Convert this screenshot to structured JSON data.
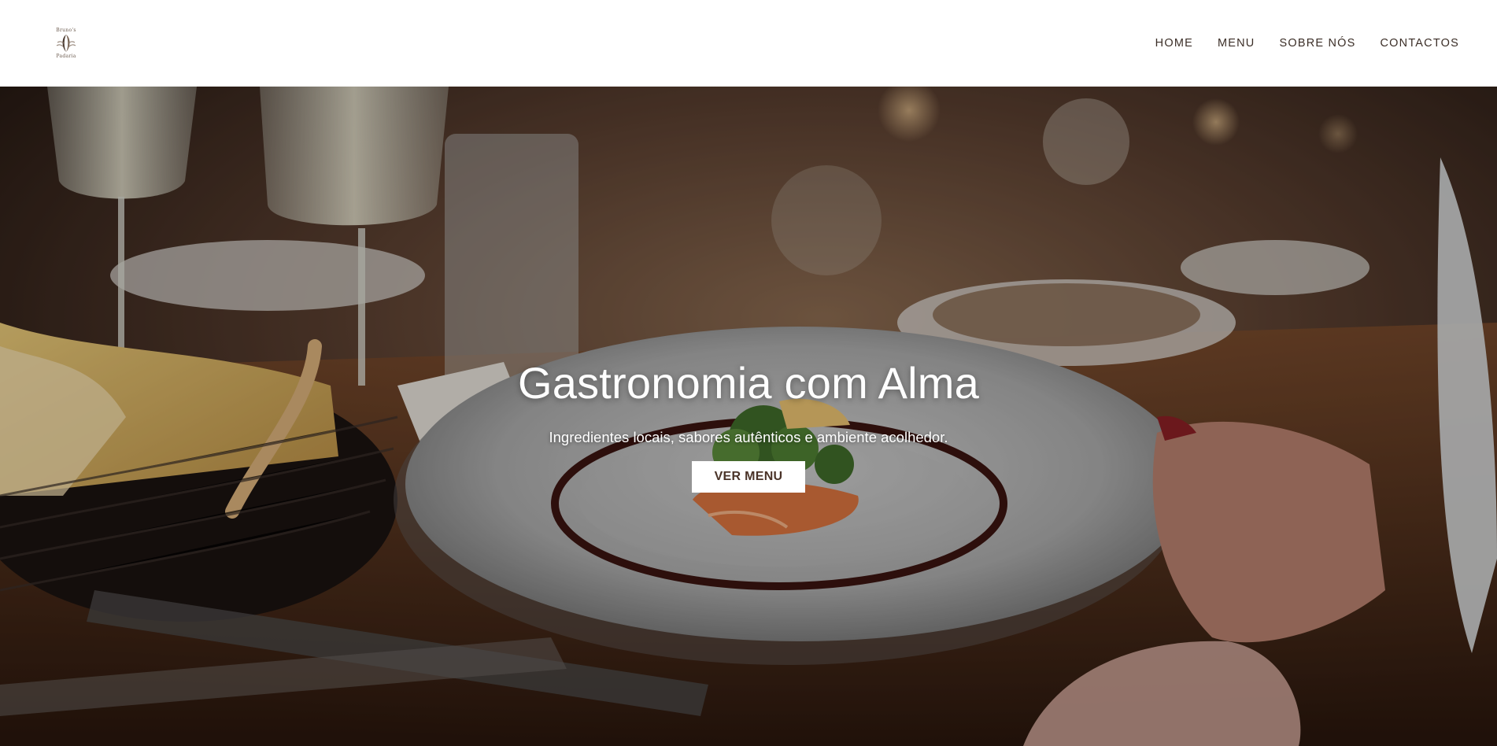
{
  "header": {
    "logo": {
      "text_top": "Bruno's",
      "text_bottom": "Padaria",
      "icon": "leaf-emblem-icon"
    },
    "nav": [
      {
        "label": "HOME"
      },
      {
        "label": "MENU"
      },
      {
        "label": "SOBRE NÓS"
      },
      {
        "label": "CONTACTOS"
      }
    ]
  },
  "hero": {
    "title": "Gastronomia com Alma",
    "subtitle": "Ingredientes locais, sabores autênticos e ambiente acolhedor.",
    "button_label": "VER MENU",
    "background_image": "restaurant-plated-dish-photo"
  },
  "colors": {
    "header_bg": "#ffffff",
    "nav_text": "#3b2e27",
    "button_bg": "#ffffff",
    "button_text": "#4a3328"
  }
}
